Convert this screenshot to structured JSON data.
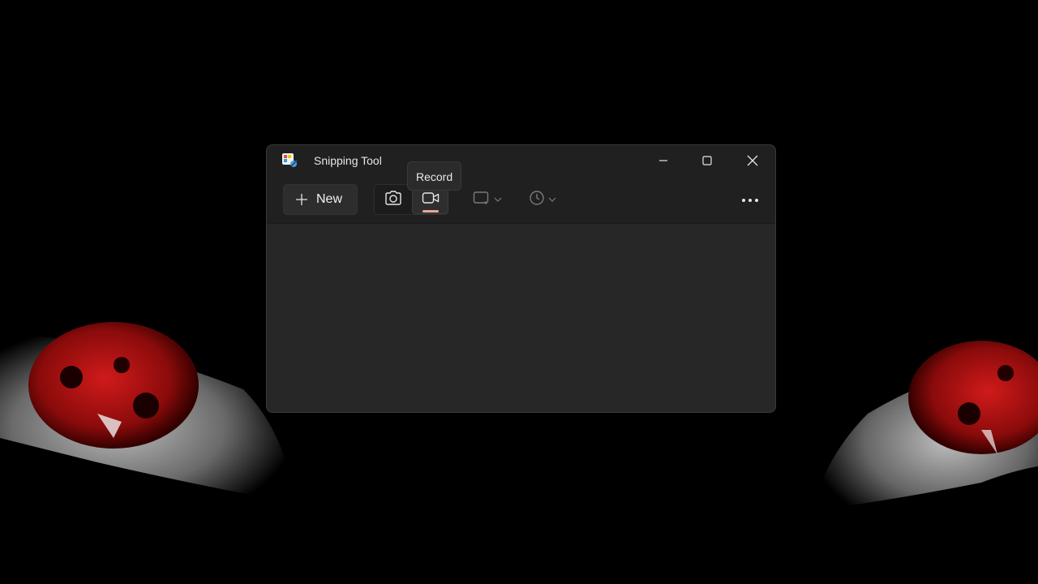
{
  "window": {
    "title": "Snipping Tool",
    "controls": {
      "minimize": "minimize-icon",
      "maximize": "maximize-icon",
      "close": "close-icon"
    }
  },
  "toolbar": {
    "new_label": "New",
    "snip_mode_icon": "camera-icon",
    "record_mode_icon": "video-camera-icon",
    "selected_mode": "record",
    "shape_icon": "rectangle-snip-icon",
    "timer_icon": "clock-icon",
    "more_icon": "more-dots-icon"
  },
  "tooltip": {
    "text": "Record"
  },
  "colors": {
    "window_bg": "#272727",
    "titlebar_bg": "#202020",
    "accent_indicator": "#e8a598",
    "text": "#e6e6e6",
    "disabled_icon": "#7a7a7a"
  }
}
